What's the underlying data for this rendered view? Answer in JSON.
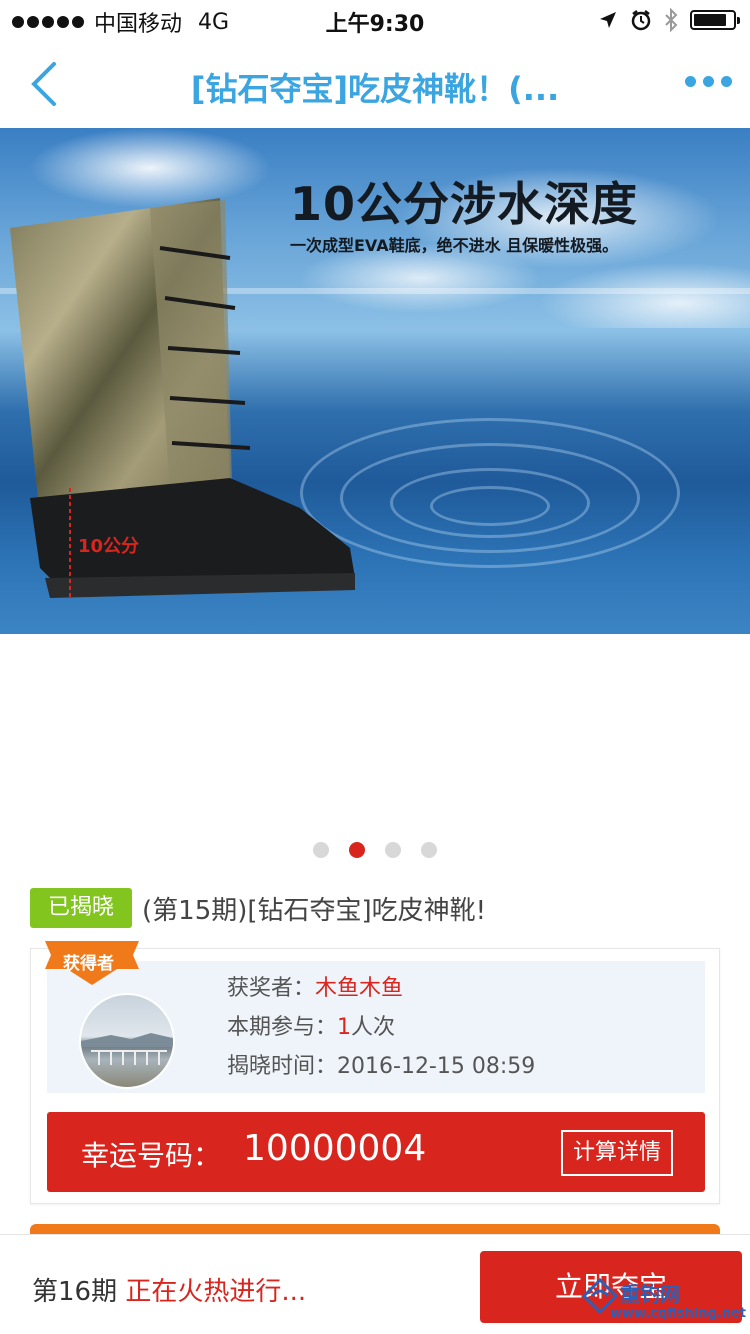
{
  "status_bar": {
    "carrier": "中国移动",
    "network": "4G",
    "time": "上午9:30",
    "battery_level": 0.85
  },
  "nav": {
    "title": "[钻石夺宝]吃皮神靴！(..."
  },
  "banner": {
    "headline": "10公分涉水深度",
    "subline": "一次成型EVA鞋底，绝不进水 且保暖性极强。",
    "boot_label": "10公分"
  },
  "carousel": {
    "total": 4,
    "active_index": 1
  },
  "product": {
    "status_badge": "已揭晓",
    "title": "(第15期)[钻石夺宝]吃皮神靴!"
  },
  "winner": {
    "ribbon": "获得者",
    "winner_label": "获奖者：",
    "winner_name": "木鱼木鱼",
    "participation_label": "本期参与：",
    "participation_count": "1",
    "participation_unit": "人次",
    "reveal_label": "揭晓时间：",
    "reveal_time": "2016-12-15 08:59"
  },
  "lucky": {
    "label": "幸运号码：",
    "number": "10000004",
    "detail_button": "计算详情"
  },
  "bottom": {
    "period": "第16期",
    "status": "正在火热进行...",
    "buy_button": "立即夺宝"
  },
  "watermark": {
    "name": "重钓网",
    "url": "www.cqfishing.net"
  },
  "colors": {
    "accent_blue": "#3aa5e0",
    "brand_red": "#d8261f",
    "badge_green": "#82c51f",
    "orange": "#f07a1a"
  }
}
